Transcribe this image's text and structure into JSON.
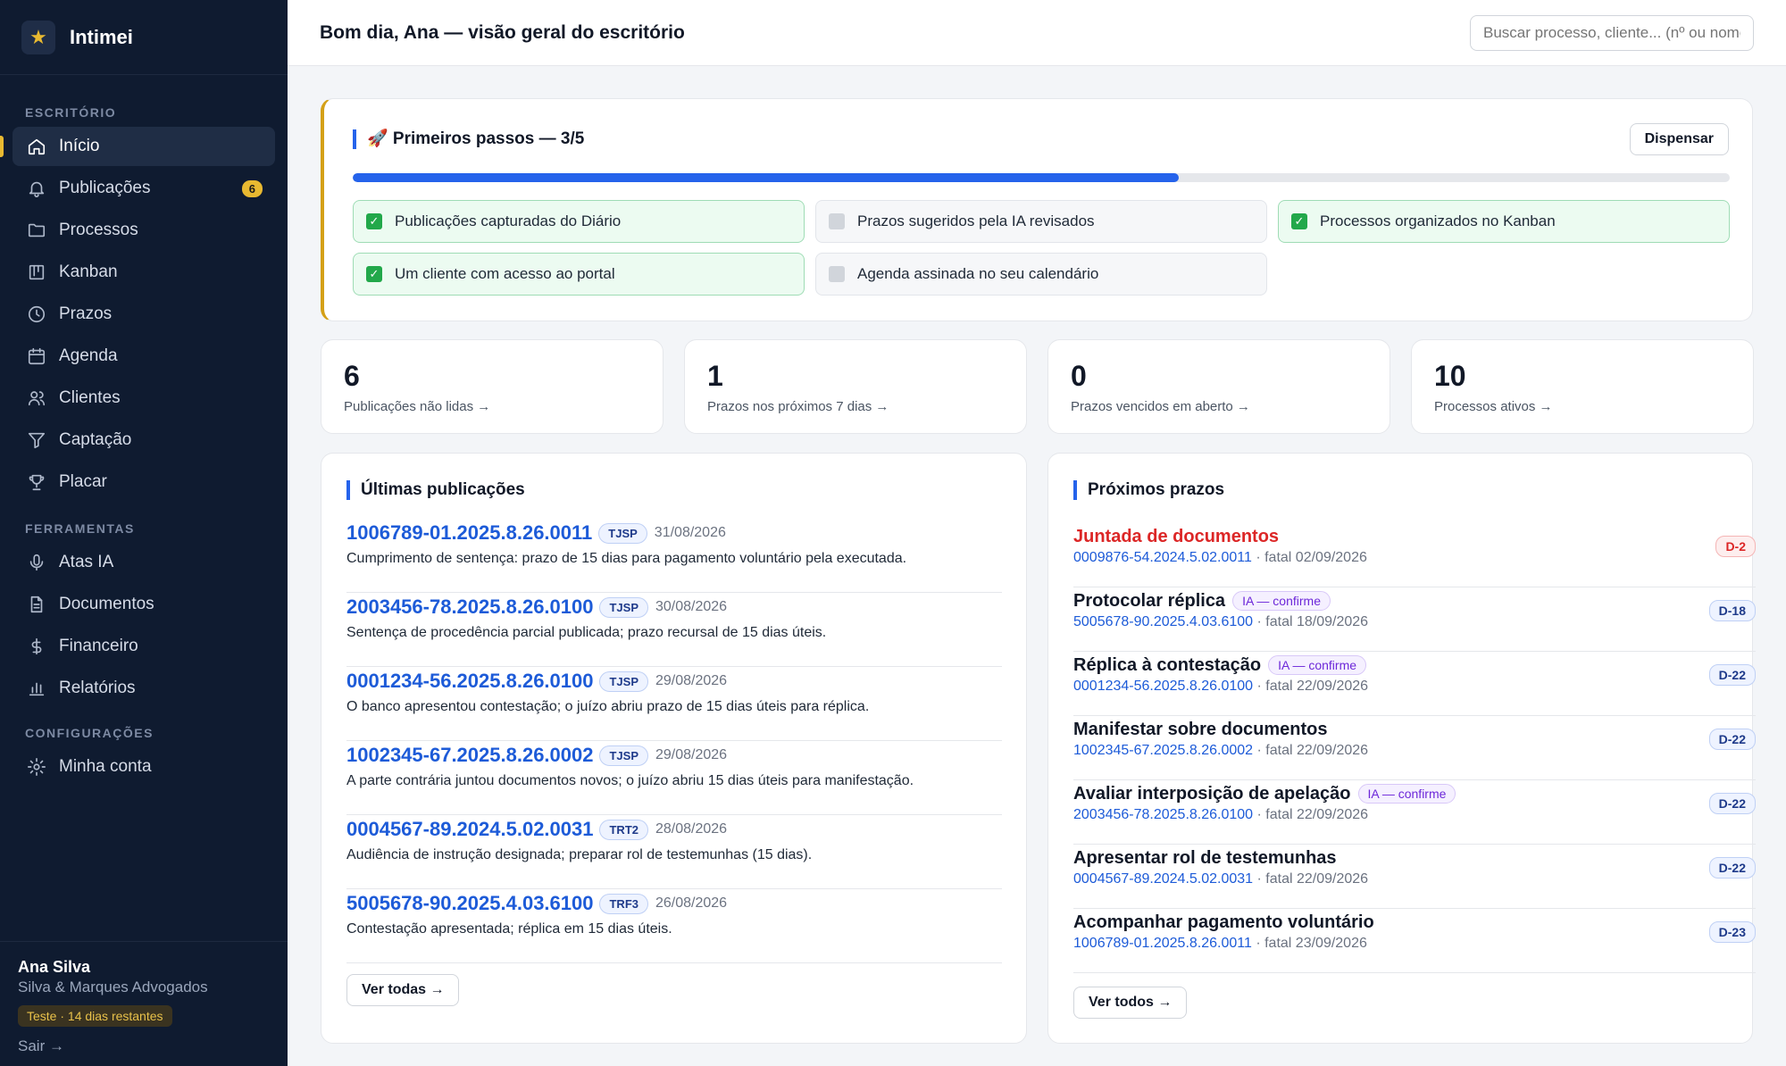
{
  "brand": {
    "name": "Intimei"
  },
  "sidebar": {
    "section_office": "ESCRITÓRIO",
    "section_tools": "FERRAMENTAS",
    "section_settings": "CONFIGURAÇÕES",
    "items": [
      {
        "label": "Início",
        "icon": "home-icon",
        "active": true
      },
      {
        "label": "Publicações",
        "icon": "bell-icon",
        "badge": "6"
      },
      {
        "label": "Processos",
        "icon": "folder-icon"
      },
      {
        "label": "Kanban",
        "icon": "kanban-icon"
      },
      {
        "label": "Prazos",
        "icon": "clock-icon"
      },
      {
        "label": "Agenda",
        "icon": "calendar-icon"
      },
      {
        "label": "Clientes",
        "icon": "users-icon"
      },
      {
        "label": "Captação",
        "icon": "filter-icon"
      },
      {
        "label": "Placar",
        "icon": "trophy-icon"
      },
      {
        "label": "Atas IA",
        "icon": "microphone-icon"
      },
      {
        "label": "Documentos",
        "icon": "document-icon"
      },
      {
        "label": "Financeiro",
        "icon": "dollar-icon"
      },
      {
        "label": "Relatórios",
        "icon": "bar-chart-icon"
      },
      {
        "label": "Minha conta",
        "icon": "gear-icon"
      }
    ],
    "user": {
      "name": "Ana Silva",
      "firm": "Silva & Marques Advogados",
      "trial": "Teste · 14 dias restantes",
      "logout": "Sair →"
    }
  },
  "header": {
    "title": "Bom dia, Ana — visão geral do escritório",
    "search_placeholder": "Buscar processo, cliente... (nº ou nome)"
  },
  "onboarding": {
    "title": "🚀 Primeiros passos — 3/5",
    "dismiss": "Dispensar",
    "progress": 0.6,
    "steps": [
      {
        "label": "Publicações capturadas do Diário",
        "done": true
      },
      {
        "label": "Prazos sugeridos pela IA revisados",
        "done": false
      },
      {
        "label": "Processos organizados no Kanban",
        "done": true
      },
      {
        "label": "Um cliente com acesso ao portal",
        "done": true
      },
      {
        "label": "Agenda assinada no seu calendário",
        "done": false
      }
    ]
  },
  "stats": [
    {
      "value": "6",
      "label": "Publicações não lidas →"
    },
    {
      "value": "1",
      "label": "Prazos nos próximos 7 dias →"
    },
    {
      "value": "0",
      "label": "Prazos vencidos em aberto →"
    },
    {
      "value": "10",
      "label": "Processos ativos →"
    }
  ],
  "publications": {
    "title": "Últimas publicações",
    "see_all": "Ver todas →",
    "items": [
      {
        "number": "1006789-01.2025.8.26.0011",
        "court": "TJSP",
        "date": "31/08/2026",
        "desc": "Cumprimento de sentença: prazo de 15 dias para pagamento voluntário pela executada."
      },
      {
        "number": "2003456-78.2025.8.26.0100",
        "court": "TJSP",
        "date": "30/08/2026",
        "desc": "Sentença de procedência parcial publicada; prazo recursal de 15 dias úteis."
      },
      {
        "number": "0001234-56.2025.8.26.0100",
        "court": "TJSP",
        "date": "29/08/2026",
        "desc": "O banco apresentou contestação; o juízo abriu prazo de 15 dias úteis para réplica."
      },
      {
        "number": "1002345-67.2025.8.26.0002",
        "court": "TJSP",
        "date": "29/08/2026",
        "desc": "A parte contrária juntou documentos novos; o juízo abriu 15 dias úteis para manifestação."
      },
      {
        "number": "0004567-89.2024.5.02.0031",
        "court": "TRT2",
        "date": "28/08/2026",
        "desc": "Audiência de instrução designada; preparar rol de testemunhas (15 dias)."
      },
      {
        "number": "5005678-90.2025.4.03.6100",
        "court": "TRF3",
        "date": "26/08/2026",
        "desc": "Contestação apresentada; réplica em 15 dias úteis."
      }
    ]
  },
  "deadlines": {
    "title": "Próximos prazos",
    "see_all": "Ver todos →",
    "items": [
      {
        "title": "Juntada de documentos",
        "process": "0009876-54.2024.5.02.0011",
        "fatal": " · fatal 02/09/2026",
        "dday": "D-2",
        "urgent": true,
        "ia": ""
      },
      {
        "title": "Protocolar réplica",
        "process": "5005678-90.2025.4.03.6100",
        "fatal": " · fatal 18/09/2026",
        "dday": "D-18",
        "urgent": false,
        "ia": "IA — confirme"
      },
      {
        "title": "Réplica à contestação",
        "process": "0001234-56.2025.8.26.0100",
        "fatal": " · fatal 22/09/2026",
        "dday": "D-22",
        "urgent": false,
        "ia": "IA — confirme"
      },
      {
        "title": "Manifestar sobre documentos",
        "process": "1002345-67.2025.8.26.0002",
        "fatal": " · fatal 22/09/2026",
        "dday": "D-22",
        "urgent": false,
        "ia": ""
      },
      {
        "title": "Avaliar interposição de apelação",
        "process": "2003456-78.2025.8.26.0100",
        "fatal": " · fatal 22/09/2026",
        "dday": "D-22",
        "urgent": false,
        "ia": "IA — confirme"
      },
      {
        "title": "Apresentar rol de testemunhas",
        "process": "0004567-89.2024.5.02.0031",
        "fatal": " · fatal 22/09/2026",
        "dday": "D-22",
        "urgent": false,
        "ia": ""
      },
      {
        "title": "Acompanhar pagamento voluntário",
        "process": "1006789-01.2025.8.26.0011",
        "fatal": " · fatal 23/09/2026",
        "dday": "D-23",
        "urgent": false,
        "ia": ""
      }
    ]
  }
}
